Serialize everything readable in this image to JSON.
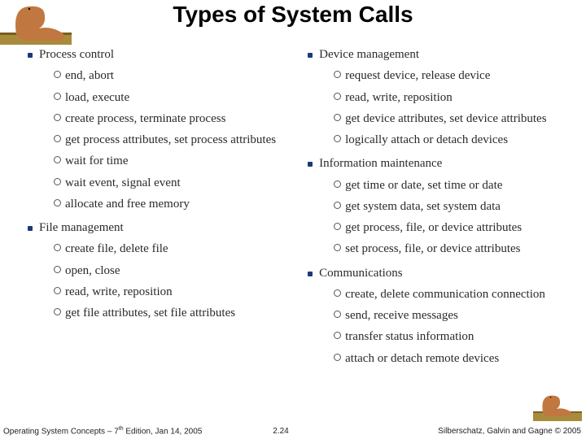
{
  "title": "Types of System Calls",
  "left": {
    "sections": [
      {
        "heading": "Process control",
        "items": [
          "end, abort",
          "load, execute",
          "create process, terminate process",
          "get process attributes, set process attributes",
          "wait for time",
          "wait event, signal event",
          "allocate and free memory"
        ]
      },
      {
        "heading": "File management",
        "items": [
          "create file, delete file",
          "open, close",
          "read, write, reposition",
          "get file attributes, set file attributes"
        ]
      }
    ]
  },
  "right": {
    "sections": [
      {
        "heading": "Device management",
        "items": [
          "request device, release device",
          "read, write, reposition",
          "get device attributes, set device attributes",
          "logically attach or detach devices"
        ]
      },
      {
        "heading": "Information maintenance",
        "items": [
          "get time or date, set time or date",
          "get system data, set system data",
          "get process, file, or device attributes",
          "set process, file, or device attributes"
        ]
      },
      {
        "heading": "Communications",
        "items": [
          "create, delete communication connection",
          "send, receive messages",
          "transfer status information",
          "attach or detach remote devices"
        ]
      }
    ]
  },
  "footer": {
    "left_a": "Operating System Concepts – 7",
    "left_b": " Edition, Jan 14, 2005",
    "center": "2.24",
    "right_a": "Silberschatz, Galvin and Gagne ",
    "right_b": " 2005",
    "copy": "©",
    "th": "th"
  },
  "icons": {
    "dino_top": "dinosaur-logo",
    "dino_bottom": "dinosaur-logo-small"
  }
}
